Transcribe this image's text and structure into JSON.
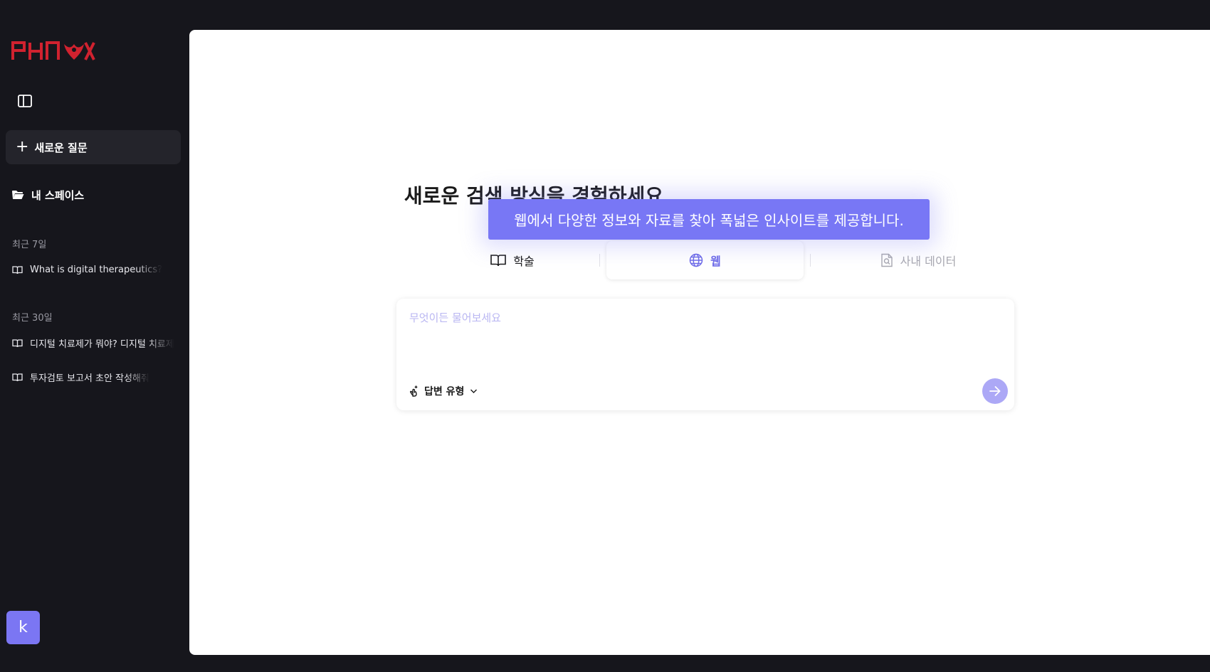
{
  "brand": {
    "logo_text": "PHNOX",
    "logo_color": "#d0222f"
  },
  "sidebar": {
    "new_question_label": "새로운 질문",
    "my_space_label": "내 스페이스",
    "recent_7_label": "최근 7일",
    "recent_7_items": [
      {
        "label": "What is digital therapeutics?"
      }
    ],
    "recent_30_label": "최근 30일",
    "recent_30_items": [
      {
        "label": "디지털 치료제가 뭐야? 디지털 치료제"
      },
      {
        "label": "투자검토 보고서 초안 작성해줘"
      }
    ],
    "avatar_letter": "k"
  },
  "main": {
    "headline": "새로운 검색 방식을 경험하세요",
    "tooltip": "웹에서 다양한 정보와 자료를 찾아 폭넓은 인사이트를 제공합니다.",
    "tabs": [
      {
        "label": "학술",
        "icon": "book-icon",
        "active": false
      },
      {
        "label": "웹",
        "icon": "globe-icon",
        "active": true
      },
      {
        "label": "사내 데이터",
        "icon": "document-search-icon",
        "active": false
      }
    ],
    "search": {
      "placeholder": "무엇이든 물어보세요",
      "value": ""
    },
    "answer_type_label": "답변 유형"
  },
  "colors": {
    "accent": "#7877f5",
    "send_button": "#aca8f6",
    "sidebar_bg": "#16161c"
  }
}
